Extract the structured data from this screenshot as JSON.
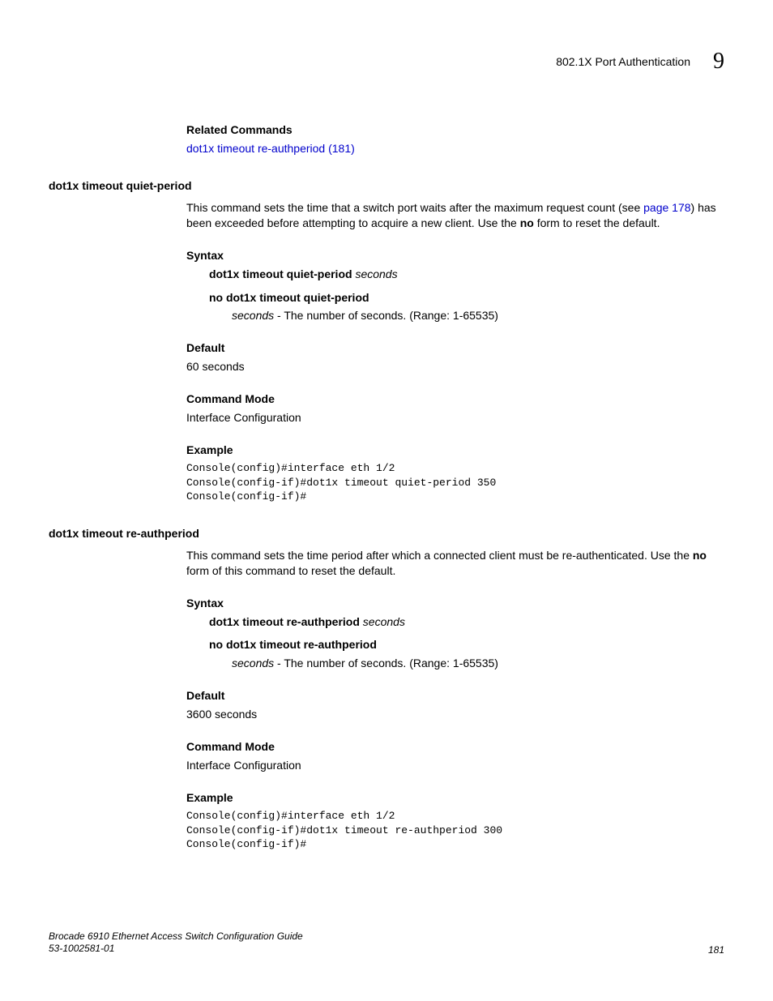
{
  "header": {
    "title": "802.1X Port Authentication",
    "chapter": "9"
  },
  "related": {
    "heading": "Related Commands",
    "link": "dot1x timeout re-authperiod (181)"
  },
  "cmd1": {
    "title": "dot1x timeout quiet-period",
    "desc_pre": "This command sets the time that a switch port waits after the maximum request count (see ",
    "desc_link": "page 178",
    "desc_post_a": ") has been exceeded before attempting to acquire a new client. Use the ",
    "desc_no": "no",
    "desc_post_b": " form to reset the default.",
    "syntax_heading": "Syntax",
    "syntax_cmd": "dot1x timeout quiet-period",
    "syntax_arg": "seconds",
    "syntax_no": "no dot1x timeout quiet-period",
    "arg_name": "seconds",
    "arg_desc": " - The number of seconds. (Range: 1-65535)",
    "default_heading": "Default",
    "default_value": "60 seconds",
    "mode_heading": "Command Mode",
    "mode_value": "Interface Configuration",
    "example_heading": "Example",
    "example_code": "Console(config)#interface eth 1/2\nConsole(config-if)#dot1x timeout quiet-period 350\nConsole(config-if)#"
  },
  "cmd2": {
    "title": "dot1x timeout re-authperiod",
    "desc_a": "This command sets the time period after which a connected client must be re-authenticated. Use the ",
    "desc_no": "no",
    "desc_b": " form of this command to reset the default.",
    "syntax_heading": "Syntax",
    "syntax_cmd": "dot1x timeout re-authperiod",
    "syntax_arg": "seconds",
    "syntax_no": "no dot1x timeout re-authperiod",
    "arg_name": "seconds",
    "arg_desc": " - The number of seconds. (Range: 1-65535)",
    "default_heading": "Default",
    "default_value": "3600 seconds",
    "mode_heading": "Command Mode",
    "mode_value": "Interface Configuration",
    "example_heading": "Example",
    "example_code": "Console(config)#interface eth 1/2\nConsole(config-if)#dot1x timeout re-authperiod 300\nConsole(config-if)#"
  },
  "footer": {
    "guide": "Brocade 6910 Ethernet Access Switch Configuration Guide",
    "doc": "53-1002581-01",
    "page": "181"
  }
}
